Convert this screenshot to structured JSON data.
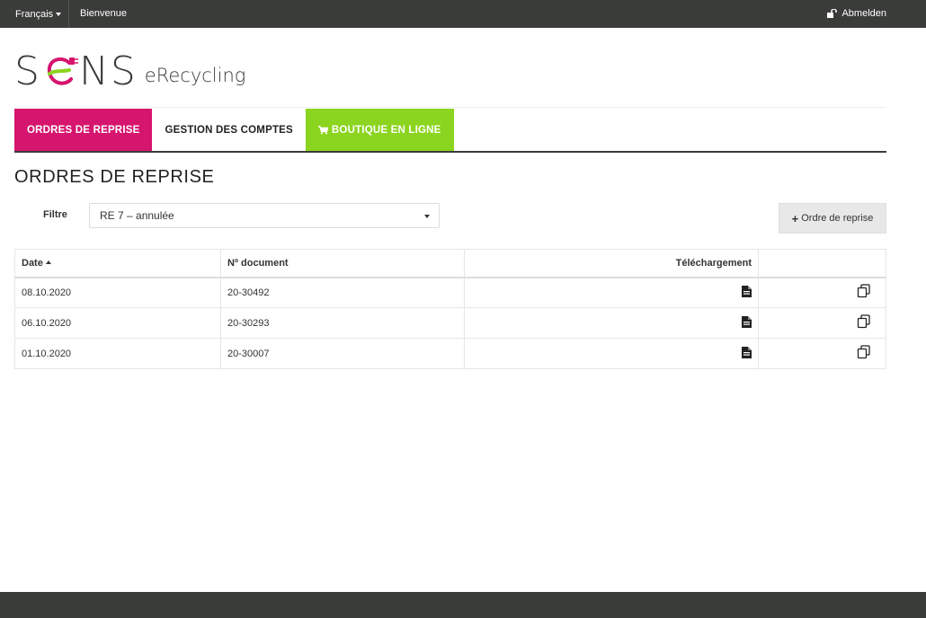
{
  "topbar": {
    "language": "Français",
    "welcome": "Bienvenue",
    "logout": "Abmelden"
  },
  "logo": {
    "main": "SENS",
    "sub": "eRecycling"
  },
  "tabs": [
    {
      "label": "ORDRES DE REPRISE"
    },
    {
      "label": "GESTION DES COMPTES"
    },
    {
      "label": "BOUTIQUE EN LIGNE"
    }
  ],
  "page": {
    "title": "ORDRES DE REPRISE",
    "filter_label": "Filtre",
    "filter_value": "RE 7 – annulée",
    "add_button": "Ordre de reprise"
  },
  "table": {
    "headers": {
      "date": "Date",
      "document": "Nº document",
      "download": "Téléchargement"
    },
    "rows": [
      {
        "date": "08.10.2020",
        "document": "20-30492"
      },
      {
        "date": "06.10.2020",
        "document": "20-30293"
      },
      {
        "date": "01.10.2020",
        "document": "20-30007"
      }
    ]
  },
  "colors": {
    "topbar": "#3a3c3a",
    "tab_active": "#d6156e",
    "tab_shop": "#8bd41f",
    "button_bg": "#e8e8e8"
  },
  "icons": {
    "download": "file-icon",
    "copy": "copy-icon",
    "logout": "unlock-icon",
    "shop": "cart-icon"
  }
}
